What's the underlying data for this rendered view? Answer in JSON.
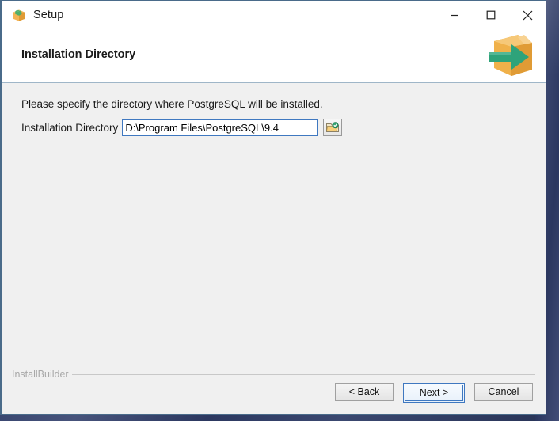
{
  "window": {
    "title": "Setup",
    "icon": "installer-package-icon",
    "controls": {
      "minimize": "minimize-icon",
      "maximize": "maximize-icon",
      "close": "close-icon"
    }
  },
  "header": {
    "title": "Installation Directory",
    "logo": "orange-box-green-arrow-logo"
  },
  "main": {
    "intro": "Please specify the directory where PostgreSQL will be installed.",
    "field": {
      "label": "Installation Directory",
      "value": "D:\\Program Files\\PostgreSQL\\9.4",
      "placeholder": "",
      "browse_icon": "folder-browse-icon"
    }
  },
  "footer": {
    "brand": "InstallBuilder",
    "buttons": {
      "back": "< Back",
      "next": "Next >",
      "cancel": "Cancel"
    }
  },
  "colors": {
    "accent_blue": "#3f78c0",
    "window_bg": "#f0f0f0",
    "header_bg": "#ffffff",
    "logo_orange": "#f0b14a",
    "logo_green": "#3aa17e",
    "desktop": "#2f3d63"
  }
}
